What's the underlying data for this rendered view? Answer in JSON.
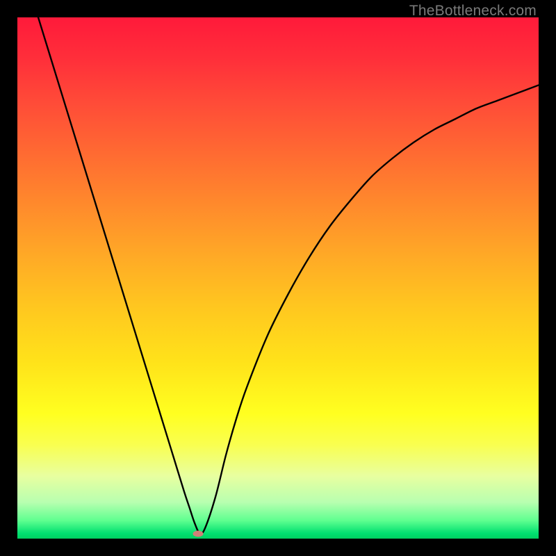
{
  "watermark": "TheBottleneck.com",
  "chart_data": {
    "type": "line",
    "title": "",
    "xlabel": "",
    "ylabel": "",
    "xlim": [
      0,
      100
    ],
    "ylim": [
      0,
      100
    ],
    "series": [
      {
        "name": "curve",
        "x": [
          4,
          8,
          12,
          16,
          20,
          24,
          28,
          30,
          32,
          33,
          34,
          35,
          36,
          38,
          40,
          42,
          44,
          48,
          52,
          56,
          60,
          64,
          68,
          72,
          76,
          80,
          84,
          88,
          92,
          96,
          100
        ],
        "y": [
          100,
          87,
          74,
          61,
          48,
          35,
          22,
          15.5,
          9,
          6,
          3,
          1,
          2,
          8,
          16,
          23,
          29,
          39,
          47,
          54,
          60,
          65,
          69.5,
          73,
          76,
          78.5,
          80.5,
          82.5,
          84,
          85.5,
          87
        ]
      }
    ],
    "marker": {
      "x": 34.7,
      "y": 0.9
    },
    "gradient_bands": [
      {
        "stop": 0,
        "meaning": "high-bottleneck",
        "color": "#ff1a3a"
      },
      {
        "stop": 50,
        "meaning": "moderate",
        "color": "#ffc400"
      },
      {
        "stop": 90,
        "meaning": "low",
        "color": "#eaff80"
      },
      {
        "stop": 100,
        "meaning": "optimal",
        "color": "#00d060"
      }
    ]
  }
}
